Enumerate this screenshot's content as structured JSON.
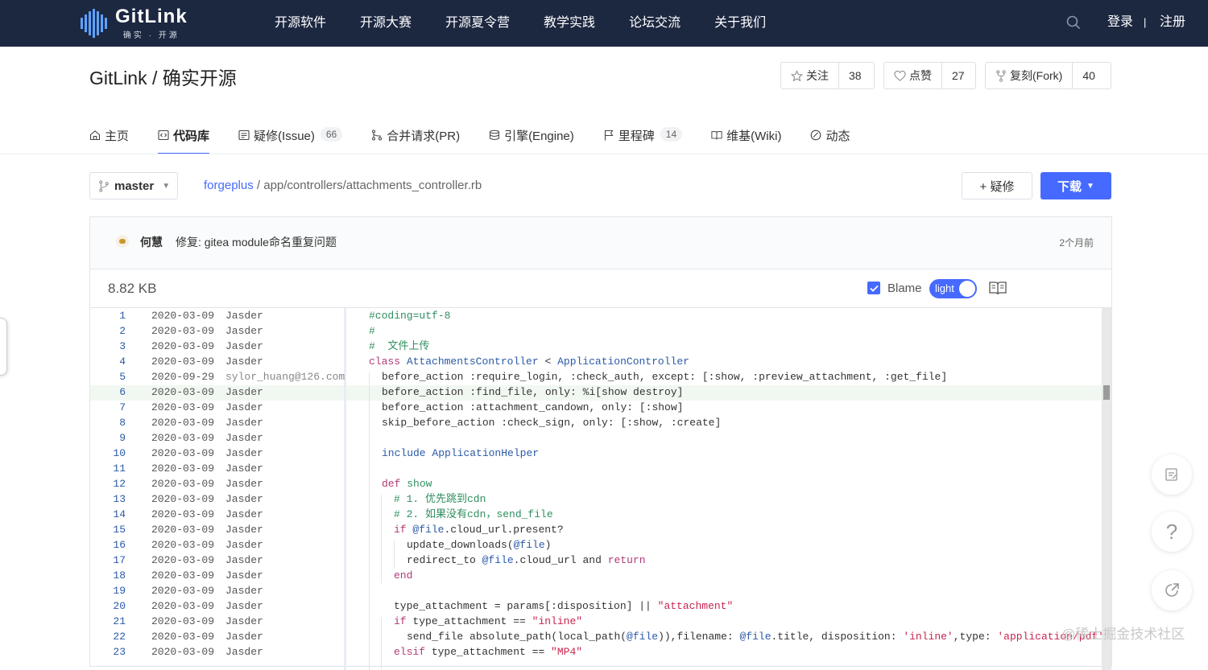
{
  "brand": {
    "name": "GitLink",
    "tagline": "确实 · 开源"
  },
  "nav": {
    "items": [
      "开源软件",
      "开源大赛",
      "开源夏令营",
      "教学实践",
      "论坛交流",
      "关于我们"
    ],
    "login": "登录",
    "separator": "|",
    "register": "注册"
  },
  "repo": {
    "title": "GitLink / 确实开源",
    "watch_label": "关注",
    "watch_count": "38",
    "like_label": "点赞",
    "like_count": "27",
    "fork_label": "复刻(Fork)",
    "fork_count": "40"
  },
  "tabs": [
    {
      "label": "主页",
      "icon": "home-icon"
    },
    {
      "label": "代码库",
      "icon": "code-icon",
      "active": true
    },
    {
      "label": "疑修(Issue)",
      "icon": "issue-icon",
      "badge": "66"
    },
    {
      "label": "合并请求(PR)",
      "icon": "merge-icon"
    },
    {
      "label": "引擎(Engine)",
      "icon": "engine-icon"
    },
    {
      "label": "里程碑",
      "icon": "flag-icon",
      "badge": "14"
    },
    {
      "label": "维基(Wiki)",
      "icon": "book-icon"
    },
    {
      "label": "动态",
      "icon": "activity-icon"
    }
  ],
  "branch": {
    "name": "master"
  },
  "path": {
    "root": "forgeplus",
    "rest": "/ app/controllers/attachments_controller.rb"
  },
  "actions": {
    "new_issue": "+ 疑修",
    "download": "下载"
  },
  "commit": {
    "author": "何慧",
    "message": "修复: gitea module命名重复问题",
    "time": "2个月前"
  },
  "file": {
    "size": "8.82 KB",
    "blame_label": "Blame",
    "theme_label": "light"
  },
  "colors": {
    "nav_bg": "#1c2740",
    "accent": "#466aff"
  },
  "blame": [
    {
      "ln": "1",
      "date": "2020-03-09",
      "author": "Jasder"
    },
    {
      "ln": "2",
      "date": "2020-03-09",
      "author": "Jasder"
    },
    {
      "ln": "3",
      "date": "2020-03-09",
      "author": "Jasder"
    },
    {
      "ln": "4",
      "date": "2020-03-09",
      "author": "Jasder"
    },
    {
      "ln": "5",
      "date": "2020-09-29",
      "author": "sylor_huang@126.com"
    },
    {
      "ln": "6",
      "date": "2020-03-09",
      "author": "Jasder"
    },
    {
      "ln": "7",
      "date": "2020-03-09",
      "author": "Jasder"
    },
    {
      "ln": "8",
      "date": "2020-03-09",
      "author": "Jasder"
    },
    {
      "ln": "9",
      "date": "2020-03-09",
      "author": "Jasder"
    },
    {
      "ln": "10",
      "date": "2020-03-09",
      "author": "Jasder"
    },
    {
      "ln": "11",
      "date": "2020-03-09",
      "author": "Jasder"
    },
    {
      "ln": "12",
      "date": "2020-03-09",
      "author": "Jasder"
    },
    {
      "ln": "13",
      "date": "2020-03-09",
      "author": "Jasder"
    },
    {
      "ln": "14",
      "date": "2020-03-09",
      "author": "Jasder"
    },
    {
      "ln": "15",
      "date": "2020-03-09",
      "author": "Jasder"
    },
    {
      "ln": "16",
      "date": "2020-03-09",
      "author": "Jasder"
    },
    {
      "ln": "17",
      "date": "2020-03-09",
      "author": "Jasder"
    },
    {
      "ln": "18",
      "date": "2020-03-09",
      "author": "Jasder"
    },
    {
      "ln": "19",
      "date": "2020-03-09",
      "author": "Jasder"
    },
    {
      "ln": "20",
      "date": "2020-03-09",
      "author": "Jasder"
    },
    {
      "ln": "21",
      "date": "2020-03-09",
      "author": "Jasder"
    },
    {
      "ln": "22",
      "date": "2020-03-09",
      "author": "Jasder"
    },
    {
      "ln": "23",
      "date": "2020-03-09",
      "author": "Jasder"
    }
  ],
  "code": {
    "l1": "#coding=utf-8",
    "l2": "#",
    "l3": "#  文件上传",
    "l4_kw": "class",
    "l4_cls": "AttachmentsController",
    "l4_op": "<",
    "l4_sup": "ApplicationController",
    "l5": "before_action :require_login, :check_auth, except: [:show, :preview_attachment, :get_file]",
    "l6": "before_action :find_file, only: %i[show destroy]",
    "l7": "before_action :attachment_candown, only: [:show]",
    "l8": "skip_before_action :check_sign, only: [:show, :create]",
    "l10_kw": "include",
    "l10_mod": "ApplicationHelper",
    "l12_kw": "def",
    "l12_name": "show",
    "l13": "# 1. 优先跳到cdn",
    "l14": "# 2. 如果没有cdn，send_file",
    "l15_kw": "if",
    "l15_iv": "@file",
    "l15_rest": ".cloud_url.present?",
    "l16_a": "update_downloads(",
    "l16_iv": "@file",
    "l16_b": ")",
    "l17_a": "redirect_to ",
    "l17_iv": "@file",
    "l17_b": ".cloud_url ",
    "l17_and": "and",
    "l17_ret": "return",
    "l18": "end",
    "l20_a": "type_attachment = params[:disposition] || ",
    "l20_str": "\"attachment\"",
    "l21_kw": "if",
    "l21_a": " type_attachment == ",
    "l21_str": "\"inline\"",
    "l22_a": "send_file absolute_path(local_path(",
    "l22_iv": "@file",
    "l22_b": ")),filename: ",
    "l22_iv2": "@file",
    "l22_c": ".title, disposition: ",
    "l22_str": "'inline'",
    "l22_d": ",type: ",
    "l22_str2": "'application/pdf'",
    "l23_kw": "elsif",
    "l23_a": " type_attachment == ",
    "l23_str": "\"MP4\""
  },
  "watermark": "@稀土掘金技术社区"
}
